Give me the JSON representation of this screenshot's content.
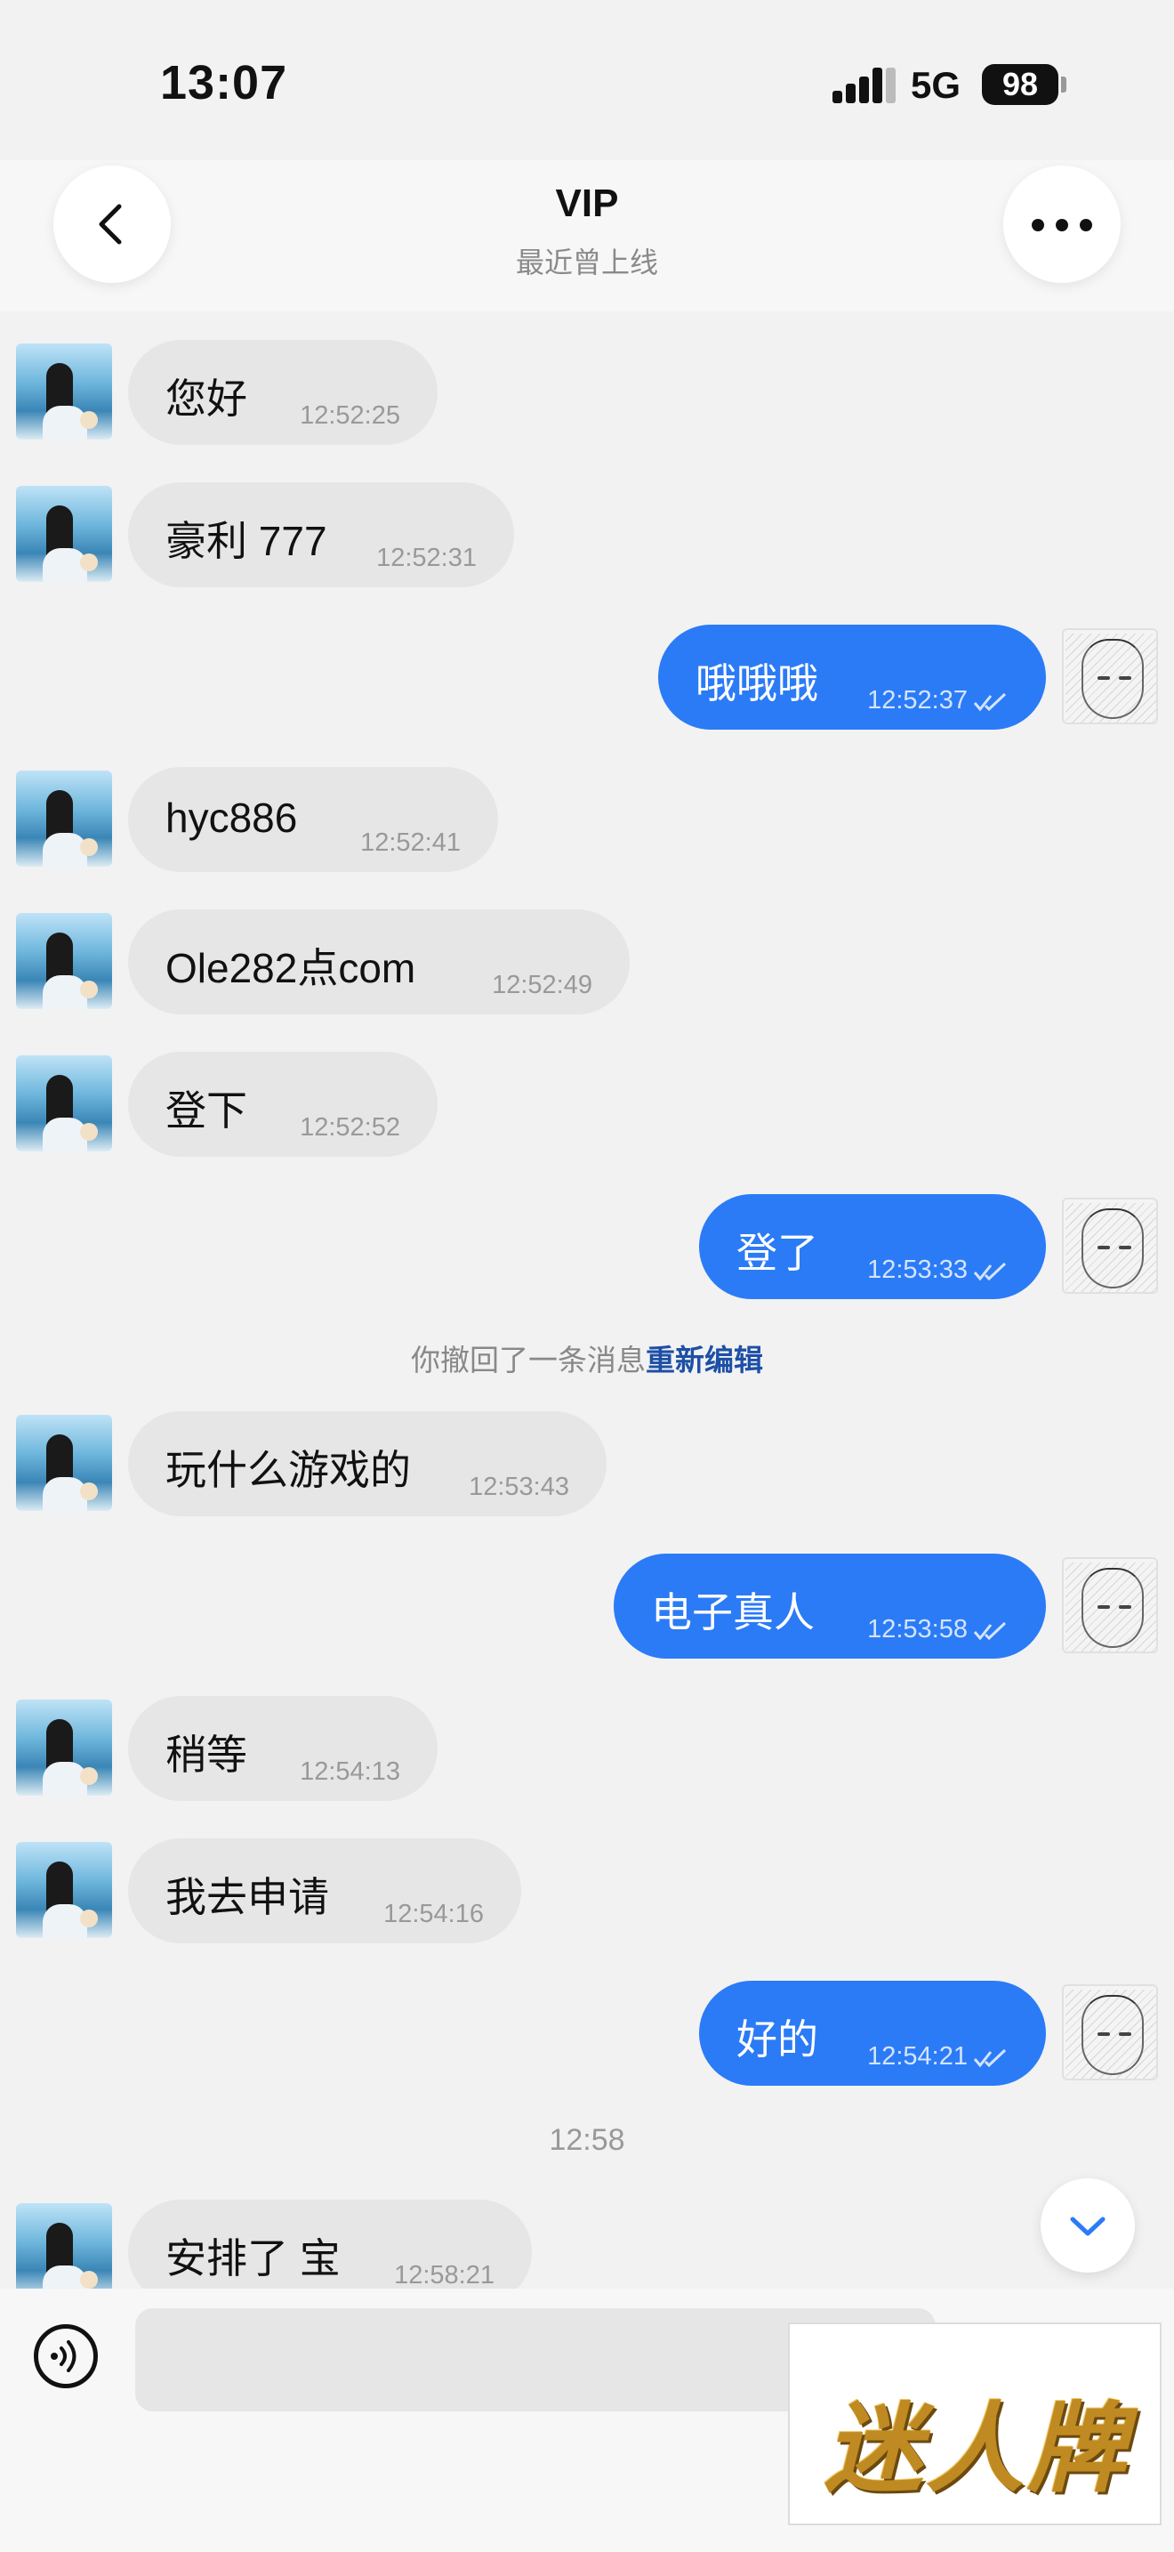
{
  "status_bar": {
    "time": "13:07",
    "network": "5G",
    "battery": "98"
  },
  "header": {
    "title": "VIP",
    "subtitle": "最近曾上线"
  },
  "messages": [
    {
      "dir": "in",
      "text": "您好",
      "time": "12:52:25"
    },
    {
      "dir": "in",
      "text": "豪利 777",
      "time": "12:52:31"
    },
    {
      "dir": "out",
      "text": "哦哦哦",
      "time": "12:52:37"
    },
    {
      "dir": "in",
      "text": "hyc886",
      "time": "12:52:41"
    },
    {
      "dir": "in",
      "text": "Ole282点com",
      "time": "12:52:49"
    },
    {
      "dir": "in",
      "text": "登下",
      "time": "12:52:52"
    },
    {
      "dir": "out",
      "text": "登了",
      "time": "12:53:33"
    },
    {
      "dir": "in",
      "text": "玩什么游戏的",
      "time": "12:53:43"
    },
    {
      "dir": "out",
      "text": "电子真人",
      "time": "12:53:58"
    },
    {
      "dir": "in",
      "text": "稍等",
      "time": "12:54:13"
    },
    {
      "dir": "in",
      "text": "我去申请",
      "time": "12:54:16"
    },
    {
      "dir": "out",
      "text": "好的",
      "time": "12:54:21"
    },
    {
      "dir": "in",
      "text": "安排了 宝",
      "time": "12:58:21"
    }
  ],
  "recall_notice": {
    "text": "你撤回了一条消息",
    "link": "重新编辑"
  },
  "time_separator": "12:58",
  "watermark": {
    "text": "迷人牌"
  },
  "colors": {
    "outgoing_bubble": "#2b7bf6",
    "incoming_bubble": "#e6e6e6",
    "link": "#1d4fa6"
  }
}
